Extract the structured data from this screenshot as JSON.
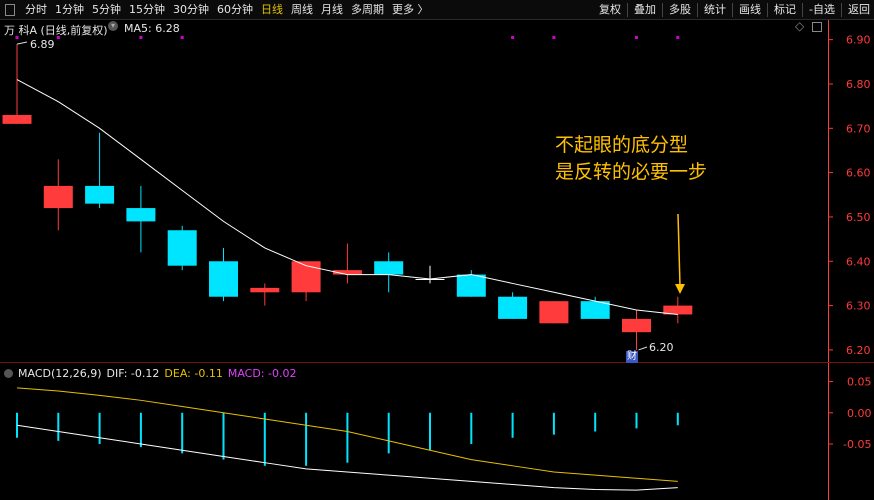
{
  "toolbar": {
    "periods": [
      "分时",
      "1分钟",
      "5分钟",
      "15分钟",
      "30分钟",
      "60分钟",
      "日线",
      "周线",
      "月线",
      "多周期",
      "更多 〉"
    ],
    "active": "日线",
    "right_tools": [
      "复权",
      "叠加",
      "多股",
      "统计",
      "画线",
      "标记",
      "-自选",
      "返回"
    ]
  },
  "main_panel": {
    "stock_label": "万 科A (日线,前复权)",
    "ma_label": "MA5: 6.28",
    "max_label": "6.89",
    "min_label": "6.20",
    "cai_badge": "财",
    "annotation_line1": "不起眼的底分型",
    "annotation_line2": "是反转的必要一步"
  },
  "macd_panel": {
    "name_label": "MACD(12,26,9)",
    "dif_label": "DIF: -0.12",
    "dea_label": "DEA: -0.11",
    "macd_label": "MACD: -0.02"
  },
  "colors": {
    "up": "#ff3b3b",
    "down": "#00e5ff",
    "ma5": "#ffffff",
    "dea": "#e8c000",
    "macd_label": "#e040fb",
    "annotation": "#ffc000",
    "axis": "#ff3b3b",
    "event_dot": "#d000d0"
  },
  "chart_data": [
    {
      "type": "candlestick",
      "title": "万 科A (日线,前复权)",
      "y_ticks": [
        6.9,
        6.8,
        6.7,
        6.6,
        6.5,
        6.4,
        6.3,
        6.2
      ],
      "ylim": [
        6.175,
        6.915
      ],
      "candles": [
        {
          "o": 6.71,
          "c": 6.73,
          "h": 6.89,
          "l": 6.71
        },
        {
          "o": 6.52,
          "c": 6.57,
          "h": 6.63,
          "l": 6.47
        },
        {
          "o": 6.57,
          "c": 6.53,
          "h": 6.69,
          "l": 6.52
        },
        {
          "o": 6.52,
          "c": 6.49,
          "h": 6.57,
          "l": 6.42
        },
        {
          "o": 6.47,
          "c": 6.39,
          "h": 6.48,
          "l": 6.38
        },
        {
          "o": 6.4,
          "c": 6.32,
          "h": 6.43,
          "l": 6.31
        },
        {
          "o": 6.33,
          "c": 6.34,
          "h": 6.35,
          "l": 6.3
        },
        {
          "o": 6.33,
          "c": 6.4,
          "h": 6.4,
          "l": 6.31
        },
        {
          "o": 6.37,
          "c": 6.38,
          "h": 6.44,
          "l": 6.35
        },
        {
          "o": 6.4,
          "c": 6.37,
          "h": 6.42,
          "l": 6.33
        },
        {
          "o": 6.36,
          "c": 6.36,
          "h": 6.39,
          "l": 6.35
        },
        {
          "o": 6.37,
          "c": 6.32,
          "h": 6.38,
          "l": 6.32
        },
        {
          "o": 6.32,
          "c": 6.27,
          "h": 6.33,
          "l": 6.27
        },
        {
          "o": 6.26,
          "c": 6.31,
          "h": 6.31,
          "l": 6.26
        },
        {
          "o": 6.31,
          "c": 6.27,
          "h": 6.32,
          "l": 6.27
        },
        {
          "o": 6.24,
          "c": 6.27,
          "h": 6.29,
          "l": 6.2
        },
        {
          "o": 6.28,
          "c": 6.3,
          "h": 6.32,
          "l": 6.26
        }
      ],
      "ma5": [
        6.81,
        6.76,
        6.7,
        6.63,
        6.56,
        6.49,
        6.43,
        6.39,
        6.37,
        6.37,
        6.36,
        6.37,
        6.35,
        6.33,
        6.31,
        6.29,
        6.28
      ],
      "event_markers": [
        0,
        1,
        3,
        4,
        12,
        13,
        15,
        16
      ]
    },
    {
      "type": "bar",
      "title": "MACD(12,26,9)",
      "y_ticks": [
        0.05,
        0.0,
        -0.05
      ],
      "ylim": [
        -0.135,
        0.075
      ],
      "dif": [
        -0.02,
        -0.03,
        -0.04,
        -0.05,
        -0.06,
        -0.07,
        -0.08,
        -0.09,
        -0.095,
        -0.1,
        -0.105,
        -0.11,
        -0.115,
        -0.12,
        -0.123,
        -0.124,
        -0.12
      ],
      "dea": [
        0.04,
        0.035,
        0.028,
        0.02,
        0.01,
        0.0,
        -0.01,
        -0.02,
        -0.03,
        -0.045,
        -0.06,
        -0.075,
        -0.085,
        -0.095,
        -0.1,
        -0.105,
        -0.11
      ],
      "macd": [
        -0.04,
        -0.045,
        -0.05,
        -0.055,
        -0.065,
        -0.075,
        -0.085,
        -0.085,
        -0.08,
        -0.065,
        -0.06,
        -0.05,
        -0.04,
        -0.035,
        -0.03,
        -0.025,
        -0.02
      ]
    }
  ]
}
